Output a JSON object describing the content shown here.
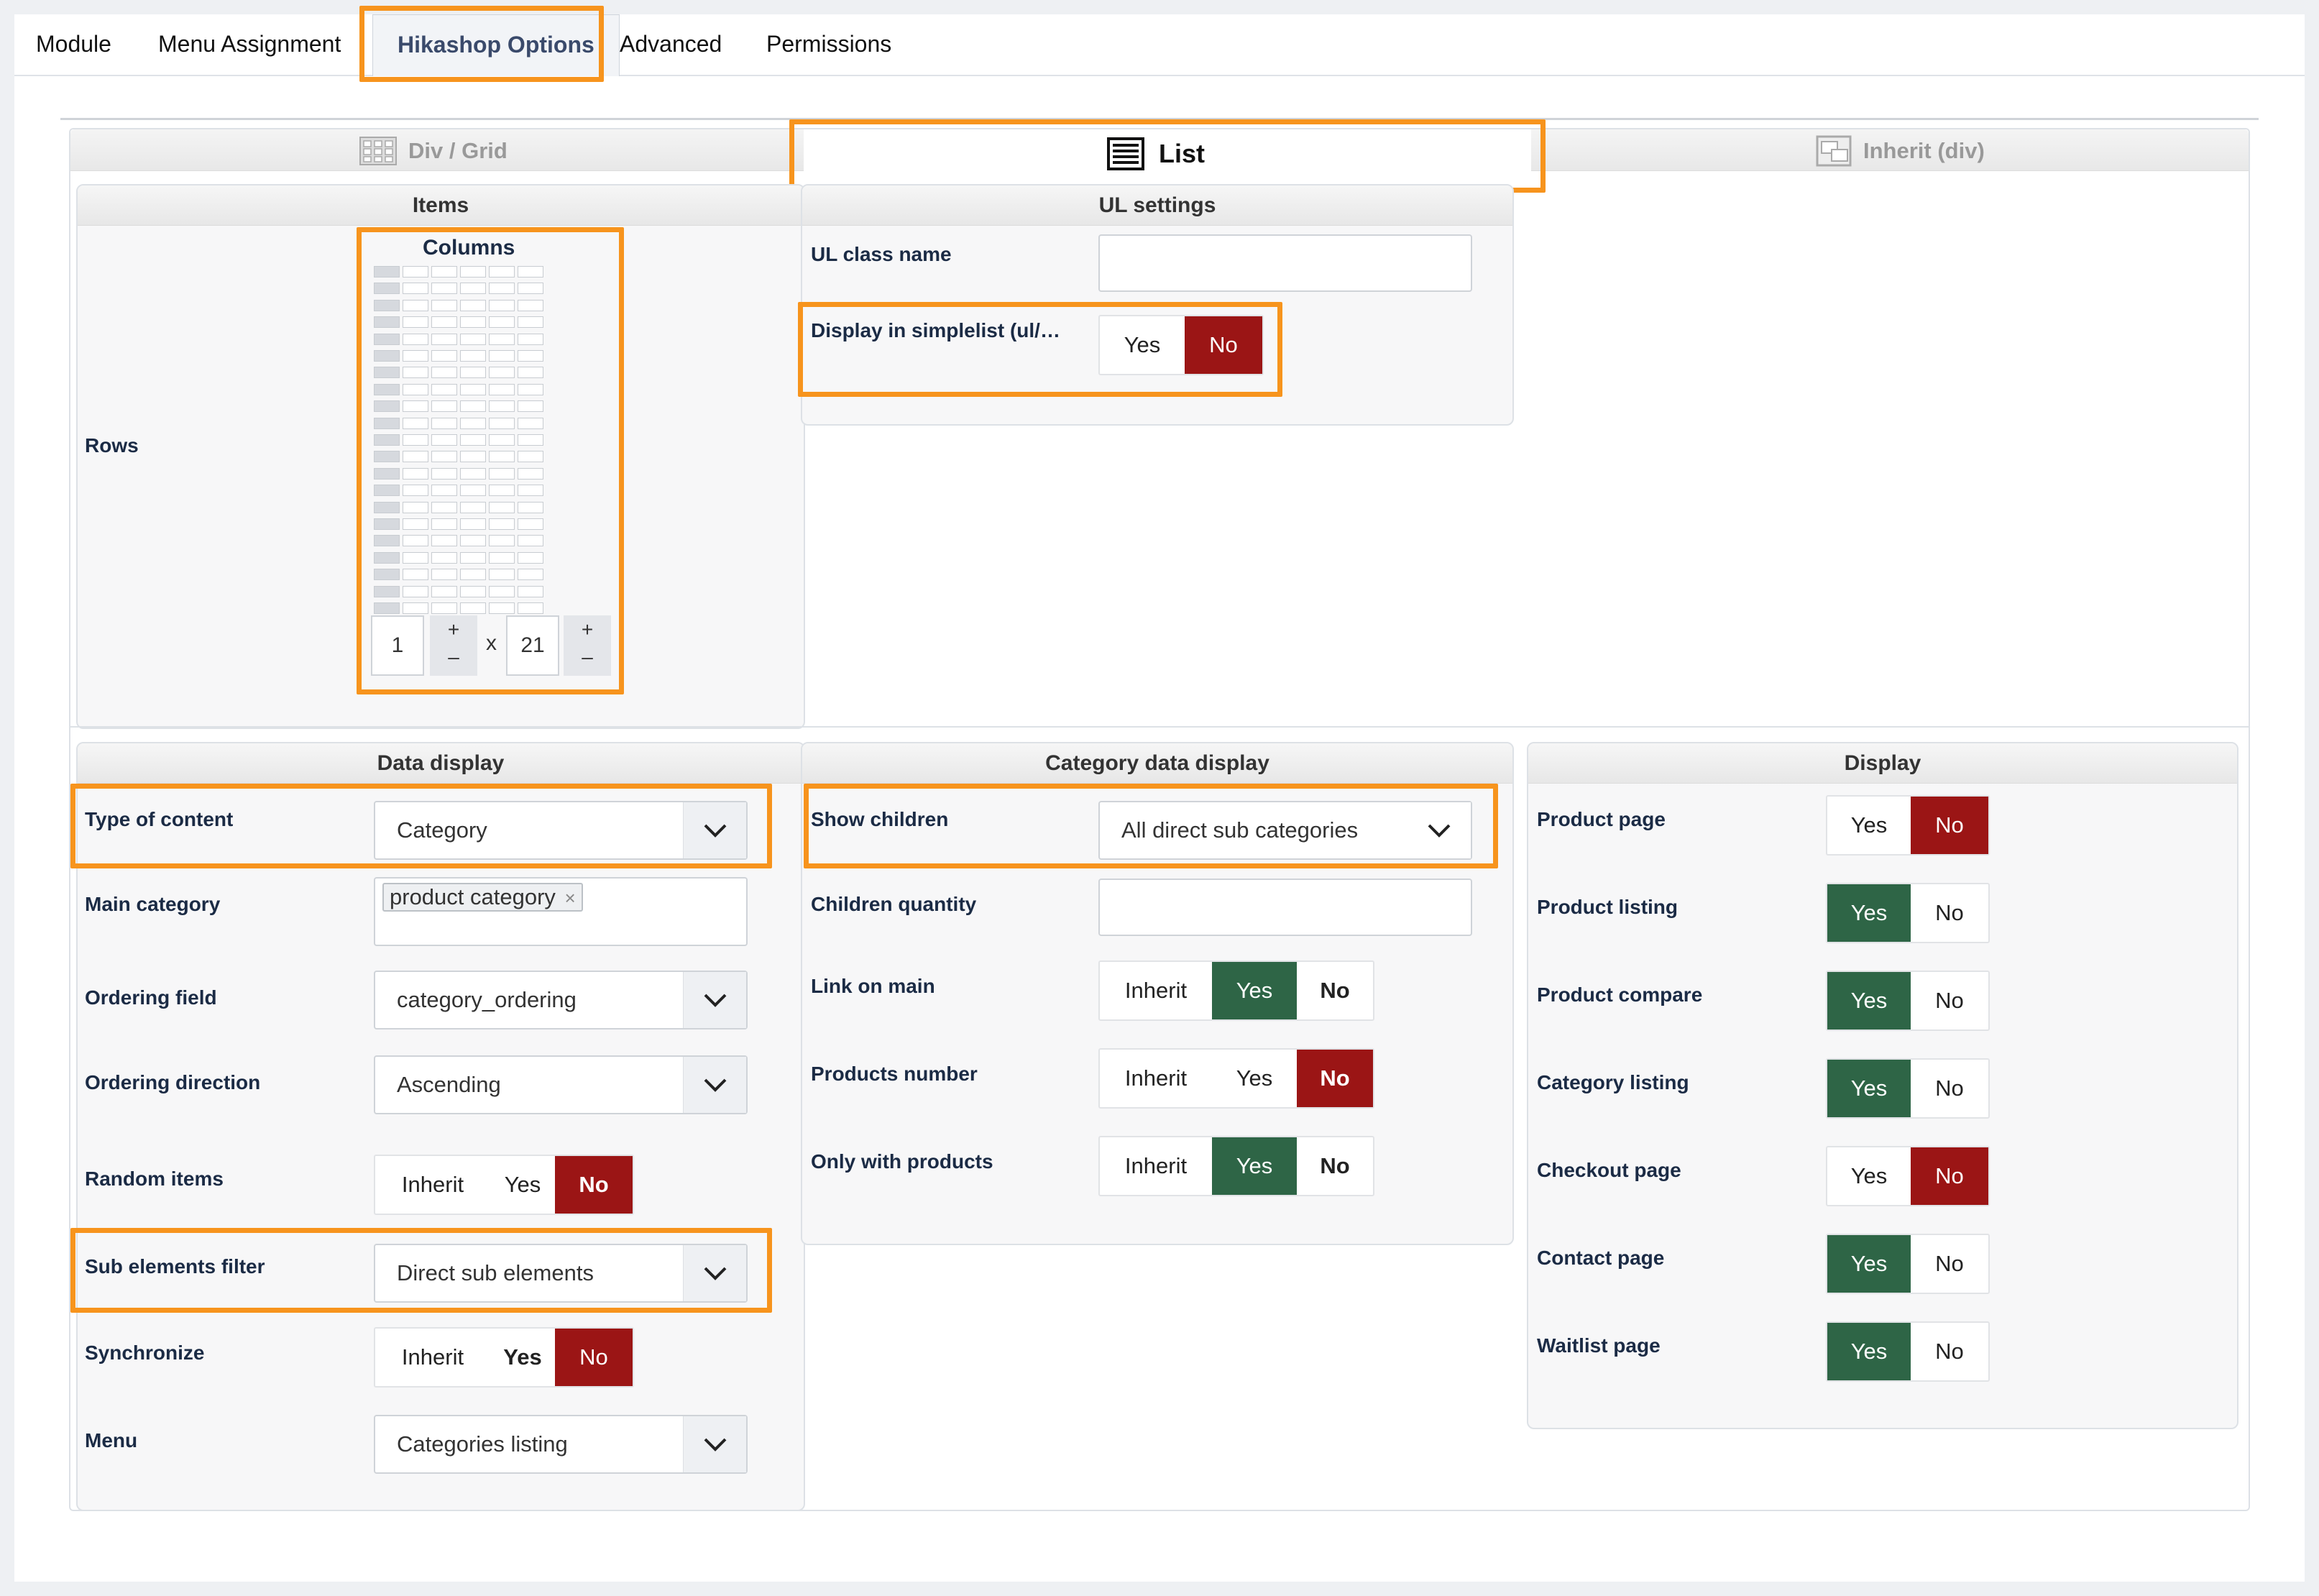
{
  "tabs": [
    "Module",
    "Menu Assignment",
    "Hikashop Options",
    "Advanced",
    "Permissions"
  ],
  "mode_tabs": {
    "div_grid": "Div / Grid",
    "list": "List",
    "inherit": "Inherit (div)"
  },
  "items": {
    "title": "Items",
    "columns_label": "Columns",
    "rows_label": "Rows",
    "columns_value": "1",
    "x_label": "x",
    "rows_value": "21",
    "plus": "+",
    "minus": "–"
  },
  "ul_settings": {
    "title": "UL settings",
    "class_label": "UL class name",
    "class_value": "",
    "simplelist_label": "Display in simplelist (ul/…",
    "simplelist_options": [
      "Yes",
      "No"
    ],
    "simplelist_selected": "No"
  },
  "data_display": {
    "title": "Data display",
    "type_label": "Type of content",
    "type_value": "Category",
    "main_label": "Main category",
    "main_tag": "product category",
    "main_tag_remove": "×",
    "ordering_label": "Ordering field",
    "ordering_value": "category_ordering",
    "direction_label": "Ordering direction",
    "direction_value": "Ascending",
    "random_label": "Random items",
    "random_options": [
      "Inherit",
      "Yes",
      "No"
    ],
    "random_selected": "No",
    "filter_label": "Sub elements filter",
    "filter_value": "Direct sub elements",
    "sync_label": "Synchronize",
    "sync_options": [
      "Inherit",
      "Yes",
      "No"
    ],
    "sync_selected": "No",
    "menu_label": "Menu",
    "menu_value": "Categories listing"
  },
  "category_display": {
    "title": "Category data display",
    "children_label": "Show children",
    "children_value": "All direct sub categories",
    "quantity_label": "Children quantity",
    "quantity_value": "",
    "link_label": "Link on main",
    "link_options": [
      "Inherit",
      "Yes",
      "No"
    ],
    "link_selected": "Yes",
    "products_label": "Products number",
    "products_options": [
      "Inherit",
      "Yes",
      "No"
    ],
    "products_selected": "No",
    "only_label": "Only with products",
    "only_options": [
      "Inherit",
      "Yes",
      "No"
    ],
    "only_selected": "Yes"
  },
  "display": {
    "title": "Display",
    "rows": [
      {
        "label": "Product page",
        "yes": "Yes",
        "no": "No",
        "selected": "No"
      },
      {
        "label": "Product listing",
        "yes": "Yes",
        "no": "No",
        "selected": "Yes"
      },
      {
        "label": "Product compare",
        "yes": "Yes",
        "no": "No",
        "selected": "Yes"
      },
      {
        "label": "Category listing",
        "yes": "Yes",
        "no": "No",
        "selected": "Yes"
      },
      {
        "label": "Checkout page",
        "yes": "Yes",
        "no": "No",
        "selected": "No"
      },
      {
        "label": "Contact page",
        "yes": "Yes",
        "no": "No",
        "selected": "Yes"
      },
      {
        "label": "Waitlist page",
        "yes": "Yes",
        "no": "No",
        "selected": "Yes"
      }
    ]
  },
  "colors": {
    "accent_highlight": "#f7941d",
    "no_active": "#9b1515",
    "yes_active": "#2e6546"
  }
}
